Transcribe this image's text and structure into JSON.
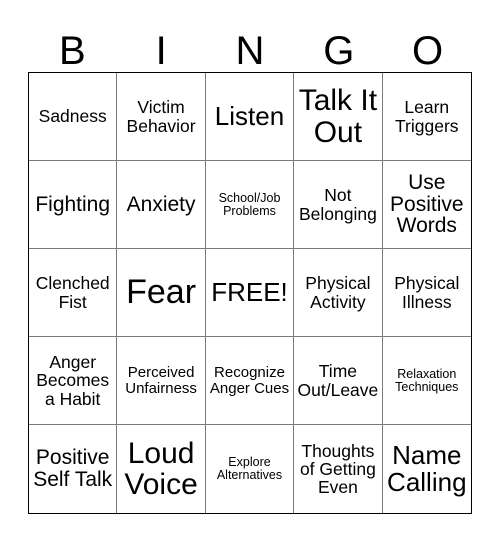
{
  "header": {
    "letters": [
      "B",
      "I",
      "N",
      "G",
      "O"
    ]
  },
  "grid": {
    "rows": 5,
    "columns": 5,
    "cells": [
      {
        "text": "Sadness",
        "size": "s-md"
      },
      {
        "text": "Victim Behavior",
        "size": "s-md"
      },
      {
        "text": "Listen",
        "size": "s-xl"
      },
      {
        "text": "Talk It Out",
        "size": "s-xxl"
      },
      {
        "text": "Learn Triggers",
        "size": "s-md"
      },
      {
        "text": "Fighting",
        "size": "s-lg"
      },
      {
        "text": "Anxiety",
        "size": "s-lg"
      },
      {
        "text": "School/Job Problems",
        "size": "s-xs"
      },
      {
        "text": "Not Belonging",
        "size": "s-md"
      },
      {
        "text": "Use Positive Words",
        "size": "s-lg"
      },
      {
        "text": "Clenched Fist",
        "size": "s-md"
      },
      {
        "text": "Fear",
        "size": "s-huge"
      },
      {
        "text": "FREE!",
        "size": "s-xl"
      },
      {
        "text": "Physical Activity",
        "size": "s-md"
      },
      {
        "text": "Physical Illness",
        "size": "s-md"
      },
      {
        "text": "Anger Becomes a Habit",
        "size": "s-md"
      },
      {
        "text": "Perceived Unfairness",
        "size": "s-sm"
      },
      {
        "text": "Recognize Anger Cues",
        "size": "s-sm"
      },
      {
        "text": "Time Out/Leave",
        "size": "s-md"
      },
      {
        "text": "Relaxation Techniques",
        "size": "s-xs"
      },
      {
        "text": "Positive Self Talk",
        "size": "s-lg"
      },
      {
        "text": "Loud Voice",
        "size": "s-xxl"
      },
      {
        "text": "Explore Alternatives",
        "size": "s-xs"
      },
      {
        "text": "Thoughts of Getting Even",
        "size": "s-md"
      },
      {
        "text": "Name Calling",
        "size": "s-xl"
      }
    ]
  },
  "colors": {
    "background": "#ffffff",
    "text": "#000000",
    "outer_border": "#000000",
    "inner_border": "#7a7a7a"
  }
}
